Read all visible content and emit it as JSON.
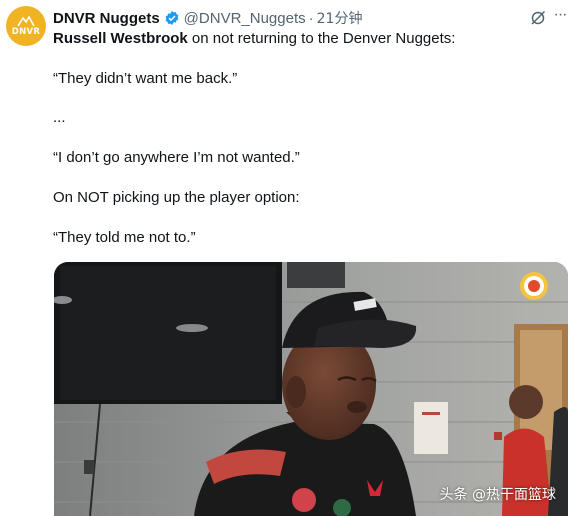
{
  "account": {
    "display_name": "DNVR Nuggets",
    "handle": "@DNVR_Nuggets",
    "separator": "·",
    "time_ago": "21分钟",
    "avatar_text": "DNVR"
  },
  "tweet": {
    "mention": "Russell Westbrook",
    "line1_rest": " on not returning to the Denver Nuggets:",
    "quote1": "“They didn’t want me back.”",
    "ellipsis": "...",
    "quote2": "“I don’t go anywhere I’m not wanted.”",
    "context2": "On NOT picking up the player option:",
    "quote3": "“They told me not to.”"
  },
  "media": {
    "watermark": "头条 @热干面篮球"
  },
  "colors": {
    "text": "#0f1419",
    "secondary": "#536471",
    "verified": "#1d9bf0",
    "avatar_bg": "#f0b323"
  },
  "icons": [
    "verified-badge-icon",
    "grok-icon",
    "more-icon"
  ]
}
